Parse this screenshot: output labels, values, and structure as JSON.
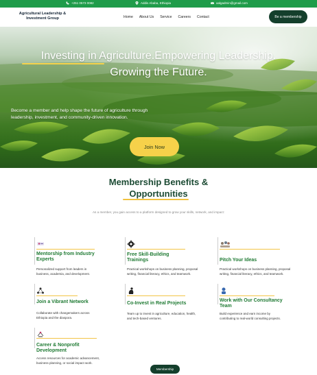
{
  "topbar": {
    "phone": "+251 0573 0082",
    "location": "Addis Ababa, Ethiopia",
    "email": "aalgadmin@gmail.com"
  },
  "nav": {
    "logo_line1": "Agricultural Leadership &",
    "logo_line2": "Investment Group",
    "items": [
      "Home",
      "About Us",
      "Service",
      "Careers",
      "Contact"
    ],
    "cta": "Be a membership"
  },
  "hero": {
    "title_line1": "Investing in Agriculture.Empowering Leadership.",
    "title_line2": "Growing the Future.",
    "subtitle_line1": "Become a member and help shape the future of agriculture through",
    "subtitle_line2": "leadership, investment, and community-driven innovation.",
    "button": "Join Now"
  },
  "section": {
    "title_line1": "Membership Benefits &",
    "title_line2": "Opportunities",
    "subtitle": "As a member, you gain access to a platform designed to grow your skills, network, and impact:"
  },
  "cards": [
    {
      "title_line1": "Mentorship from Industry",
      "title_line2": "Experts",
      "desc_line1": "Personalized support from leaders in",
      "desc_line2": "business, academia, and development."
    },
    {
      "title_line1": "Free Skill-Building",
      "title_line2": "Trainings",
      "desc_line1": "Practical workshops on business planning, proposal",
      "desc_line2": "writing, financial literacy, ethics, and teamwork."
    },
    {
      "title_line1": "Pitch Your Ideas",
      "title_line2": "",
      "desc_line1": "Practical workshops on business planning, proposal",
      "desc_line2": "writing, financial literacy, ethics, and teamwork."
    },
    {
      "title_line1": "Join a Vibrant Network",
      "title_line2": "",
      "desc_line1": "Collaborate with changemakers across",
      "desc_line2": "Ethiopia and the diaspora."
    },
    {
      "title_line1": "Co-Invest in Real Projects",
      "title_line2": "",
      "desc_line1": "Team up to invest in agriculture, education, health,",
      "desc_line2": "and tech-based ventures."
    },
    {
      "title_line1": "Work with Our Consultancy",
      "title_line2": "Team",
      "desc_line1": "Build experience and earn income by",
      "desc_line2": "contributing to real-world consulting projects."
    },
    {
      "title_line1": "Career & Nonprofit",
      "title_line2": "Development",
      "desc_line1": "Access resources for academic advancement,",
      "desc_line2": "business planning, or social impact work."
    }
  ],
  "bottom_button": "Membership",
  "colors": {
    "brand_green": "#1f9c4a",
    "dark_green": "#143f2c",
    "accent_yellow": "#f6d14a",
    "card_title": "#1f7a33"
  },
  "icons": [
    "phone-icon",
    "location-pin-icon",
    "email-icon",
    "mentorship-icon",
    "training-gear-icon",
    "pitch-icon",
    "network-icon",
    "invest-icon",
    "consultancy-icon",
    "career-icon"
  ]
}
